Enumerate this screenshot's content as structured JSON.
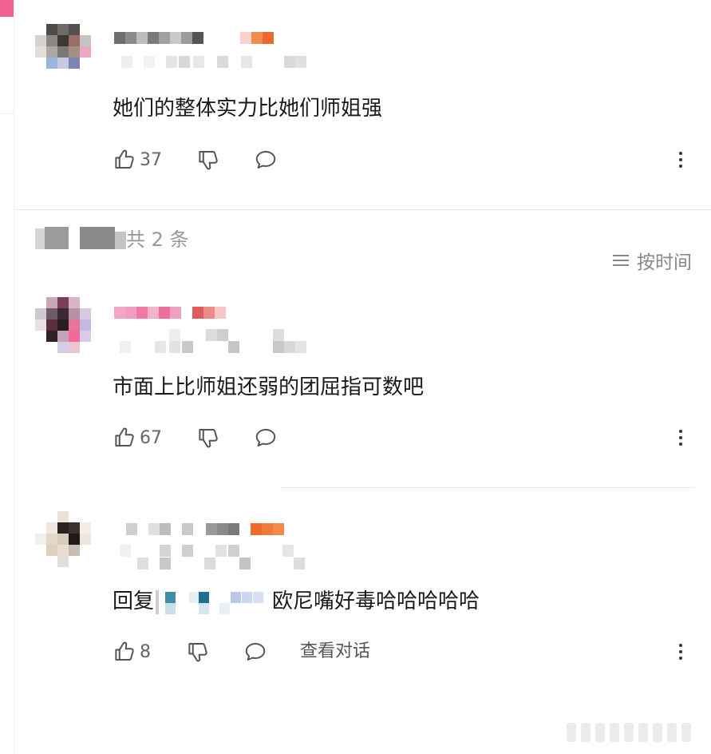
{
  "comments": [
    {
      "text": "她们的整体实力比她们师姐强",
      "likes": "37"
    },
    {
      "text": "市面上比师姐还弱的团屈指可数吧",
      "likes": "67"
    },
    {
      "reply_prefix": "回复",
      "text": "欧尼嘴好毒哈哈哈哈哈",
      "likes": "8",
      "view_conversation": "查看对话"
    }
  ],
  "section": {
    "count_label": "共 2 条"
  },
  "sort": {
    "label": "按时间"
  },
  "icons": {
    "like": "thumb-up-icon",
    "dislike": "thumb-down-icon",
    "reply": "comment-bubble-icon",
    "more": "more-vertical-icon",
    "sort": "menu-lines-icon"
  }
}
